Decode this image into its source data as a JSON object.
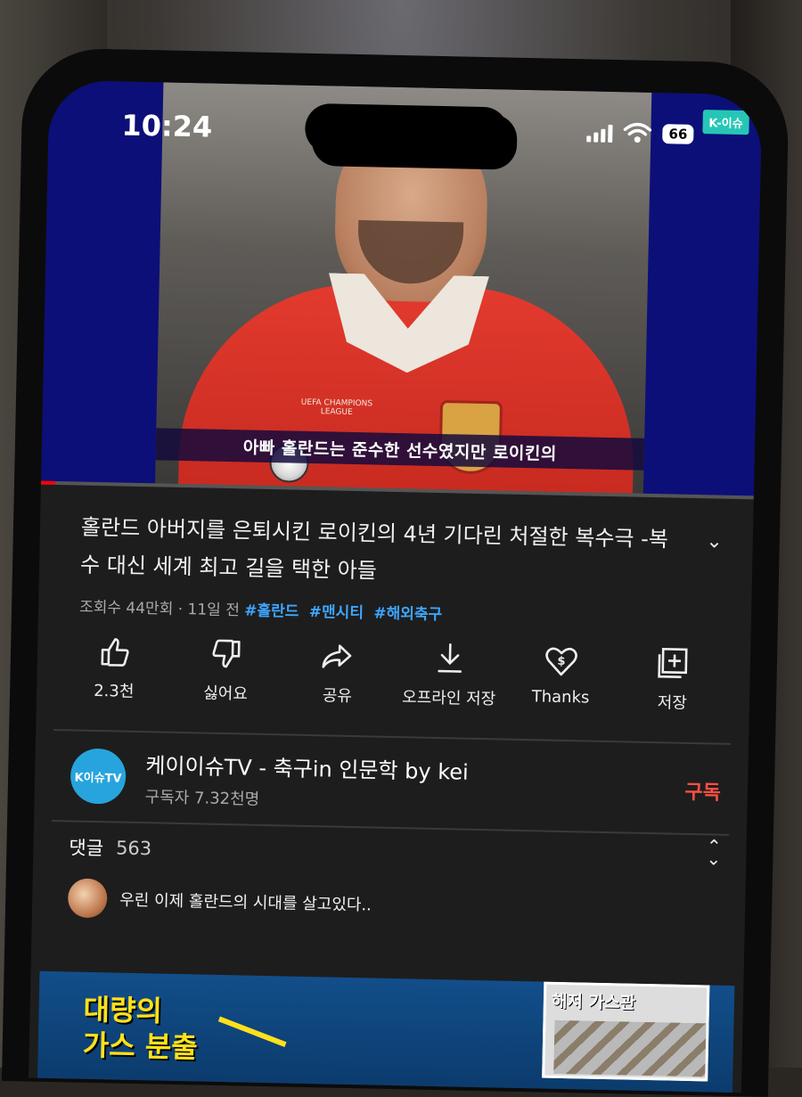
{
  "status_bar": {
    "time": "10:24",
    "battery": "66"
  },
  "video": {
    "channel_badge": "K-이슈",
    "jersey_text": "UEFA CHAMPIONS LEAGUE",
    "subtitle": "아빠 홀란드는 준수한 선수였지만 로이킨의",
    "progress": 0.02
  },
  "info": {
    "title": "홀란드 아버지를 은퇴시킨 로이킨의 4년 기다린 처절한 복수극 -복수 대신 세계 최고 길을 택한 아들",
    "meta": "조회수 44만회 · 11일 전",
    "tags": [
      "#홀란드",
      "#맨시티",
      "#해외축구"
    ]
  },
  "actions": {
    "like": "2.3천",
    "dislike": "싫어요",
    "share": "공유",
    "offline": "오프라인 저장",
    "thanks": "Thanks",
    "save": "저장"
  },
  "channel": {
    "avatar_text": "K이슈TV",
    "name": "케이이슈TV - 축구in 인문학 by kei",
    "subscribers": "구독자 7.32천명",
    "subscribe": "구독"
  },
  "comments": {
    "label": "댓글",
    "count": "563",
    "preview": "우린 이제 홀란드의 시대를 살고있다.."
  },
  "next_video": {
    "caption_line1": "대량의",
    "caption_line2": "가스 분출",
    "inset_label": "해저 가스관"
  },
  "colors": {
    "accent_red": "#ff4e45",
    "tag_blue": "#3ea6ff",
    "video_bg": "#0c0f78"
  }
}
